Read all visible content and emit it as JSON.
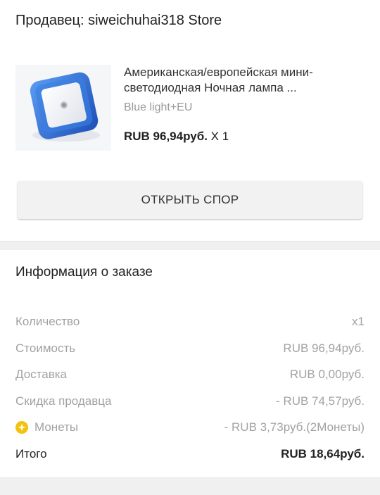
{
  "seller": {
    "label": "Продавец: siweichuhai318 Store"
  },
  "product": {
    "image_icon": "night-light-product-image",
    "title": "Американская/европейская мини-светодиодная Ночная лампа ...",
    "variant": "Blue light+EU",
    "price": "RUB 96,94руб.",
    "quantity": "X 1"
  },
  "dispute_button": {
    "label": "ОТКРЫТЬ СПОР"
  },
  "order_info": {
    "title": "Информация о заказе",
    "rows": [
      {
        "label": "Количество",
        "value": "x1"
      },
      {
        "label": "Стоимость",
        "value": "RUB 96,94руб."
      },
      {
        "label": "Доставка",
        "value": "RUB 0,00руб."
      },
      {
        "label": "Скидка продавца",
        "value": "- RUB 74,57руб."
      },
      {
        "label": "Монеты",
        "value": "- RUB 3,73руб.(2Монеты)",
        "icon": "coin-icon"
      },
      {
        "label": "Итого",
        "value": "RUB 18,64руб."
      }
    ]
  },
  "colors": {
    "coin": "#f4c20d",
    "muted_text": "#a2a2a2",
    "product_blue": "#2f6fd6"
  }
}
